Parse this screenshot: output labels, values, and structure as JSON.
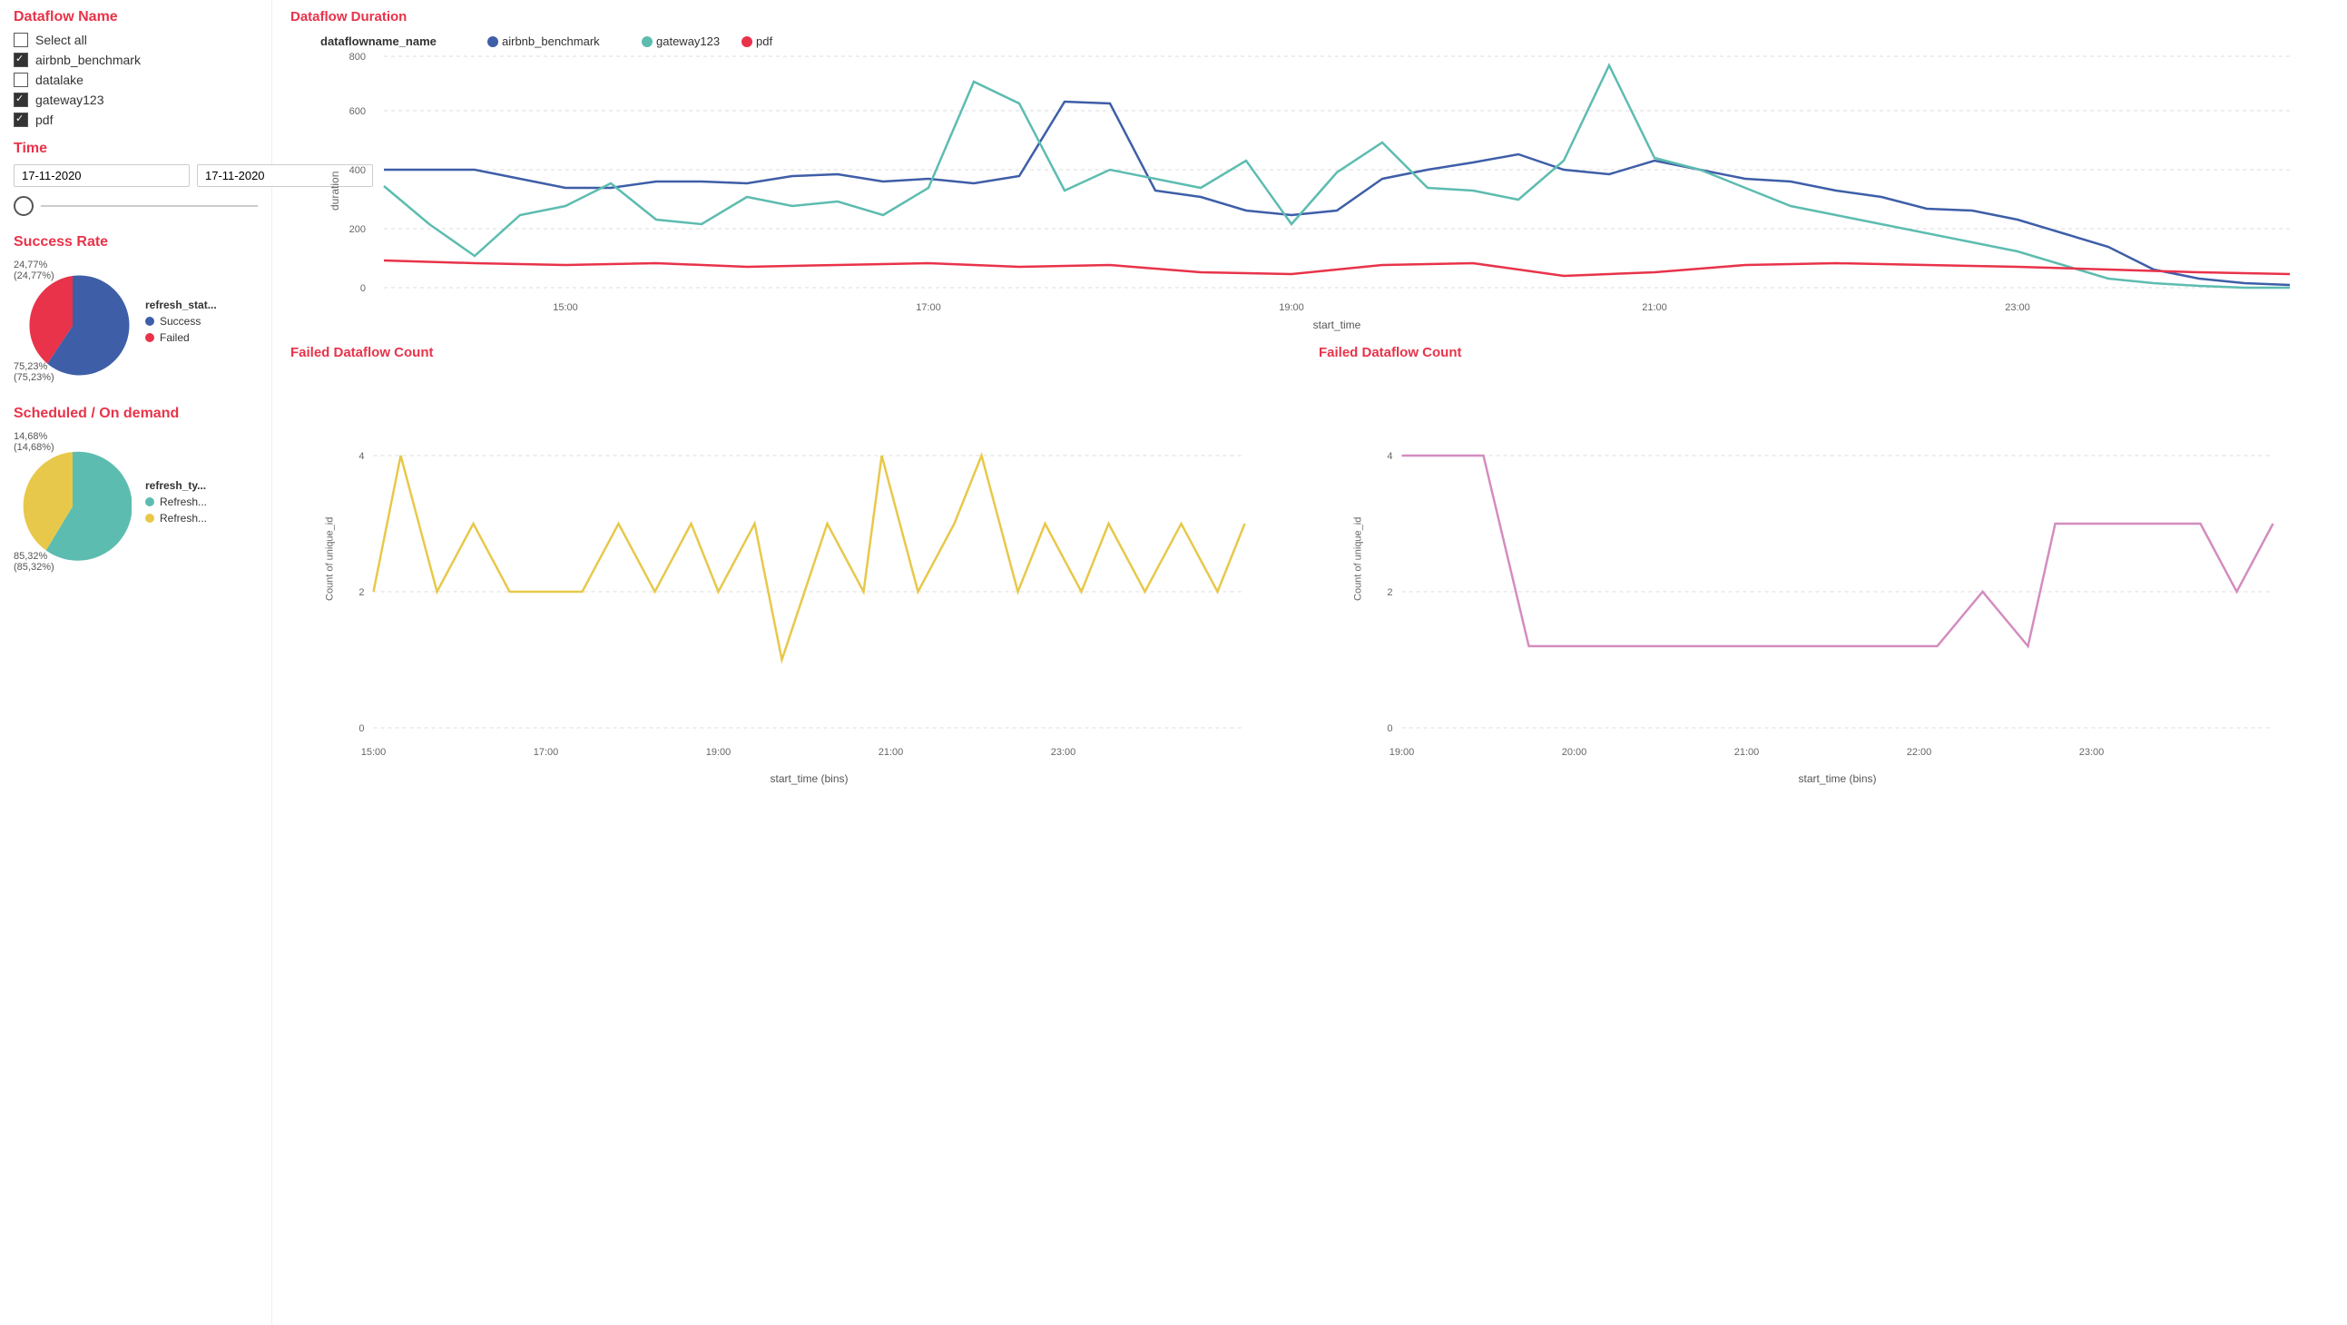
{
  "sidebar": {
    "dataflow_title": "Dataflow Name",
    "select_all_label": "Select all",
    "items": [
      {
        "label": "airbnb_benchmark",
        "checked": true
      },
      {
        "label": "datalake",
        "checked": false
      },
      {
        "label": "gateway123",
        "checked": true
      },
      {
        "label": "pdf",
        "checked": true
      }
    ],
    "time_title": "Time",
    "date_from": "17-11-2020",
    "date_to": "17-11-2020",
    "success_rate_title": "Success Rate",
    "pie1": {
      "legend_title": "refresh_stat...",
      "segments": [
        {
          "label": "Success",
          "color": "#3e5ea8",
          "pct": 75.23,
          "pct_label": "75,23%\n(75,23%)"
        },
        {
          "label": "Failed",
          "color": "#e8334a",
          "pct": 24.77,
          "pct_label": "24,77%\n(24,77%)"
        }
      ]
    },
    "scheduled_title": "Scheduled / On demand",
    "pie2": {
      "legend_title": "refresh_ty...",
      "segments": [
        {
          "label": "Refresh...",
          "color": "#5dbcb0",
          "pct": 85.32,
          "pct_label": "85,32%\n(85,32%)"
        },
        {
          "label": "Refresh...",
          "color": "#e8c84a",
          "pct": 14.68,
          "pct_label": "14,68%\n(14,68%)"
        }
      ]
    }
  },
  "charts": {
    "duration": {
      "title": "Dataflow Duration",
      "legend_title": "dataflowname_name",
      "series": [
        {
          "label": "airbnb_benchmark",
          "color": "#3e5ea8"
        },
        {
          "label": "gateway123",
          "color": "#5dbcb0"
        },
        {
          "label": "pdf",
          "color": "#e8334a"
        }
      ],
      "y_axis_label": "duration",
      "x_axis_label": "start_time",
      "y_ticks": [
        "0",
        "200",
        "400",
        "600",
        "800"
      ],
      "x_ticks": [
        "15:00",
        "17:00",
        "19:00",
        "21:00",
        "23:00"
      ]
    },
    "failed_count_1": {
      "title": "Failed Dataflow Count",
      "y_axis_label": "Count of unique_id",
      "x_axis_label": "start_time (bins)",
      "y_ticks": [
        "0",
        "2",
        "4"
      ],
      "x_ticks": [
        "15:00",
        "17:00",
        "19:00",
        "21:00",
        "23:00"
      ],
      "color": "#e8c84a"
    },
    "failed_count_2": {
      "title": "Failed Dataflow Count",
      "y_axis_label": "Count of unique_id",
      "x_axis_label": "start_time (bins)",
      "y_ticks": [
        "0",
        "2",
        "4"
      ],
      "x_ticks": [
        "19:00",
        "20:00",
        "21:00",
        "22:00",
        "23:00"
      ],
      "color": "#d48cbf"
    }
  }
}
